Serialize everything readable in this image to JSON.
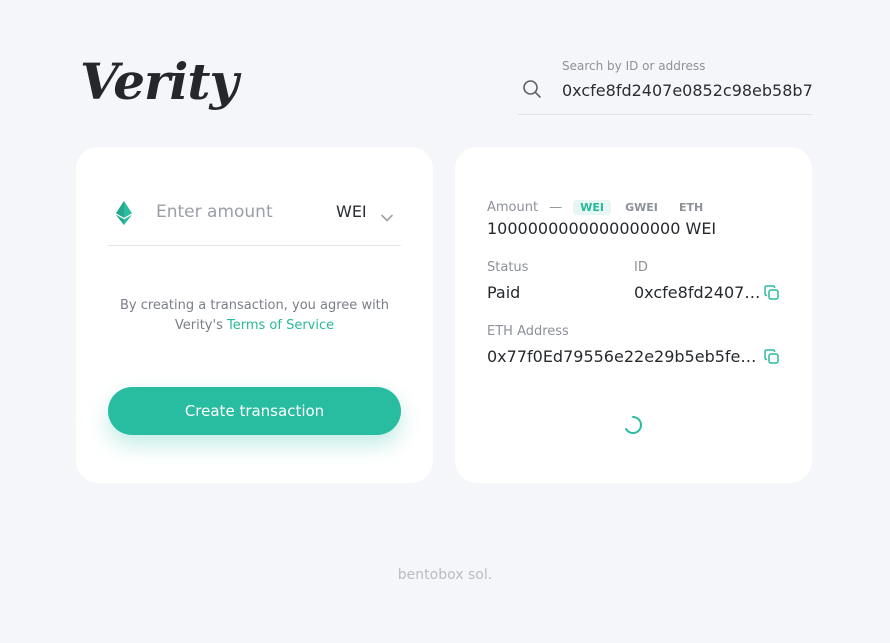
{
  "brand": {
    "logo_text": "Verity",
    "accent_color": "#28bca0"
  },
  "search": {
    "label": "Search by ID or address",
    "value": "0xcfe8fd2407e0852c98eb58b7",
    "icon": "search-icon"
  },
  "create": {
    "amount_placeholder": "Enter amount",
    "unit_selected": "WEI",
    "currency_icon": "ethereum-icon",
    "terms_prefix": "By creating a transaction, you agree with Verity's",
    "terms_link": "Terms of Service",
    "button_label": "Create transaction"
  },
  "details": {
    "amount_label": "Amount",
    "amount_separator": "—",
    "units": [
      "WEI",
      "GWEI",
      "ETH"
    ],
    "active_unit": "WEI",
    "amount_value": "1000000000000000000 WEI",
    "status_label": "Status",
    "status_value": "Paid",
    "id_label": "ID",
    "id_value": "0xcfe8fd2407…",
    "address_label": "ETH Address",
    "address_value": "0x77f0Ed79556e22e29b5eb5fe…",
    "copy_icon": "copy-icon",
    "loading_icon": "spinner-icon"
  },
  "footer": {
    "text": "bentobox sol."
  }
}
